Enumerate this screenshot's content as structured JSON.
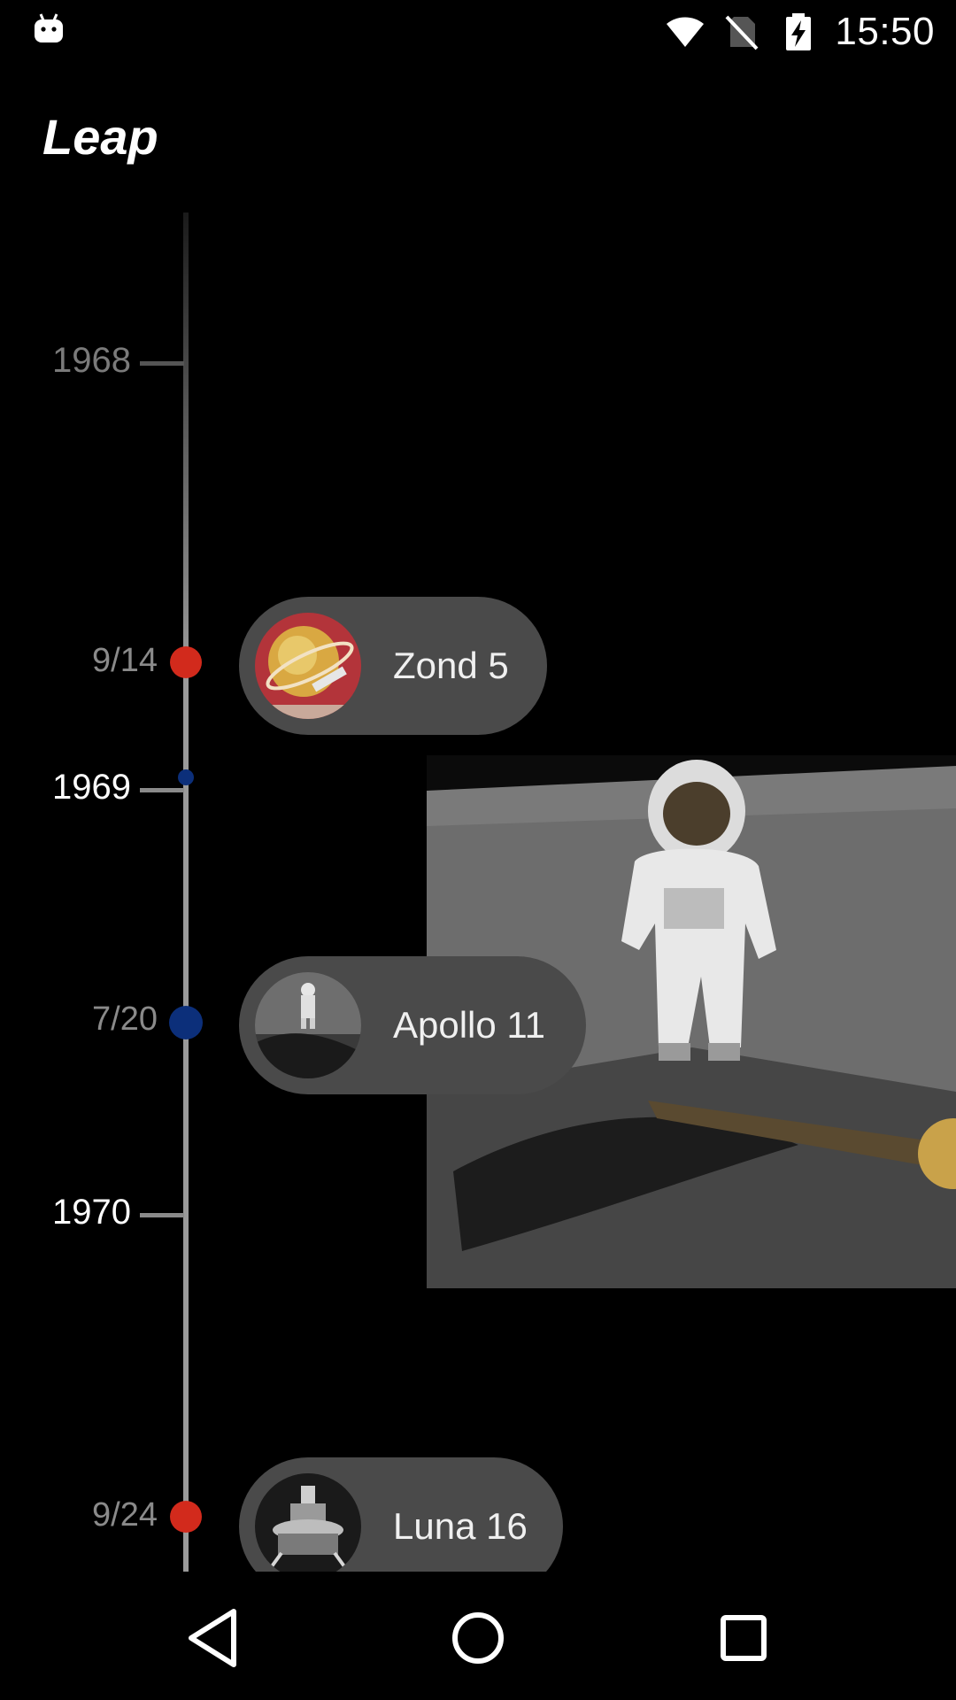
{
  "status_bar": {
    "time": "15:50",
    "icons": [
      "android-debug-icon",
      "wifi-icon",
      "no-sim-icon",
      "battery-charging-icon"
    ]
  },
  "app": {
    "title": "Leap"
  },
  "timeline": {
    "years": [
      {
        "label": "1968",
        "color": "#7a7a7a"
      },
      {
        "label": "1969",
        "color": "#ffffff"
      },
      {
        "label": "1970",
        "color": "#ffffff"
      }
    ],
    "events": [
      {
        "date": "9/14",
        "name": "Zond 5",
        "marker_color": "#d22a1c",
        "thumb": "zond-5-stamp-thumbnail"
      },
      {
        "date": "7/20",
        "name": "Apollo 11",
        "marker_color": "#0c2f7a",
        "thumb": "apollo-11-astronaut-thumbnail"
      },
      {
        "date": "9/24",
        "name": "Luna 16",
        "marker_color": "#d22a1c",
        "thumb": "luna-16-lander-thumbnail"
      }
    ]
  },
  "preview": {
    "image": "apollo-11-moonwalk-photo"
  },
  "nav_bar": {
    "icons": [
      "back-icon",
      "home-icon",
      "recents-icon"
    ]
  }
}
